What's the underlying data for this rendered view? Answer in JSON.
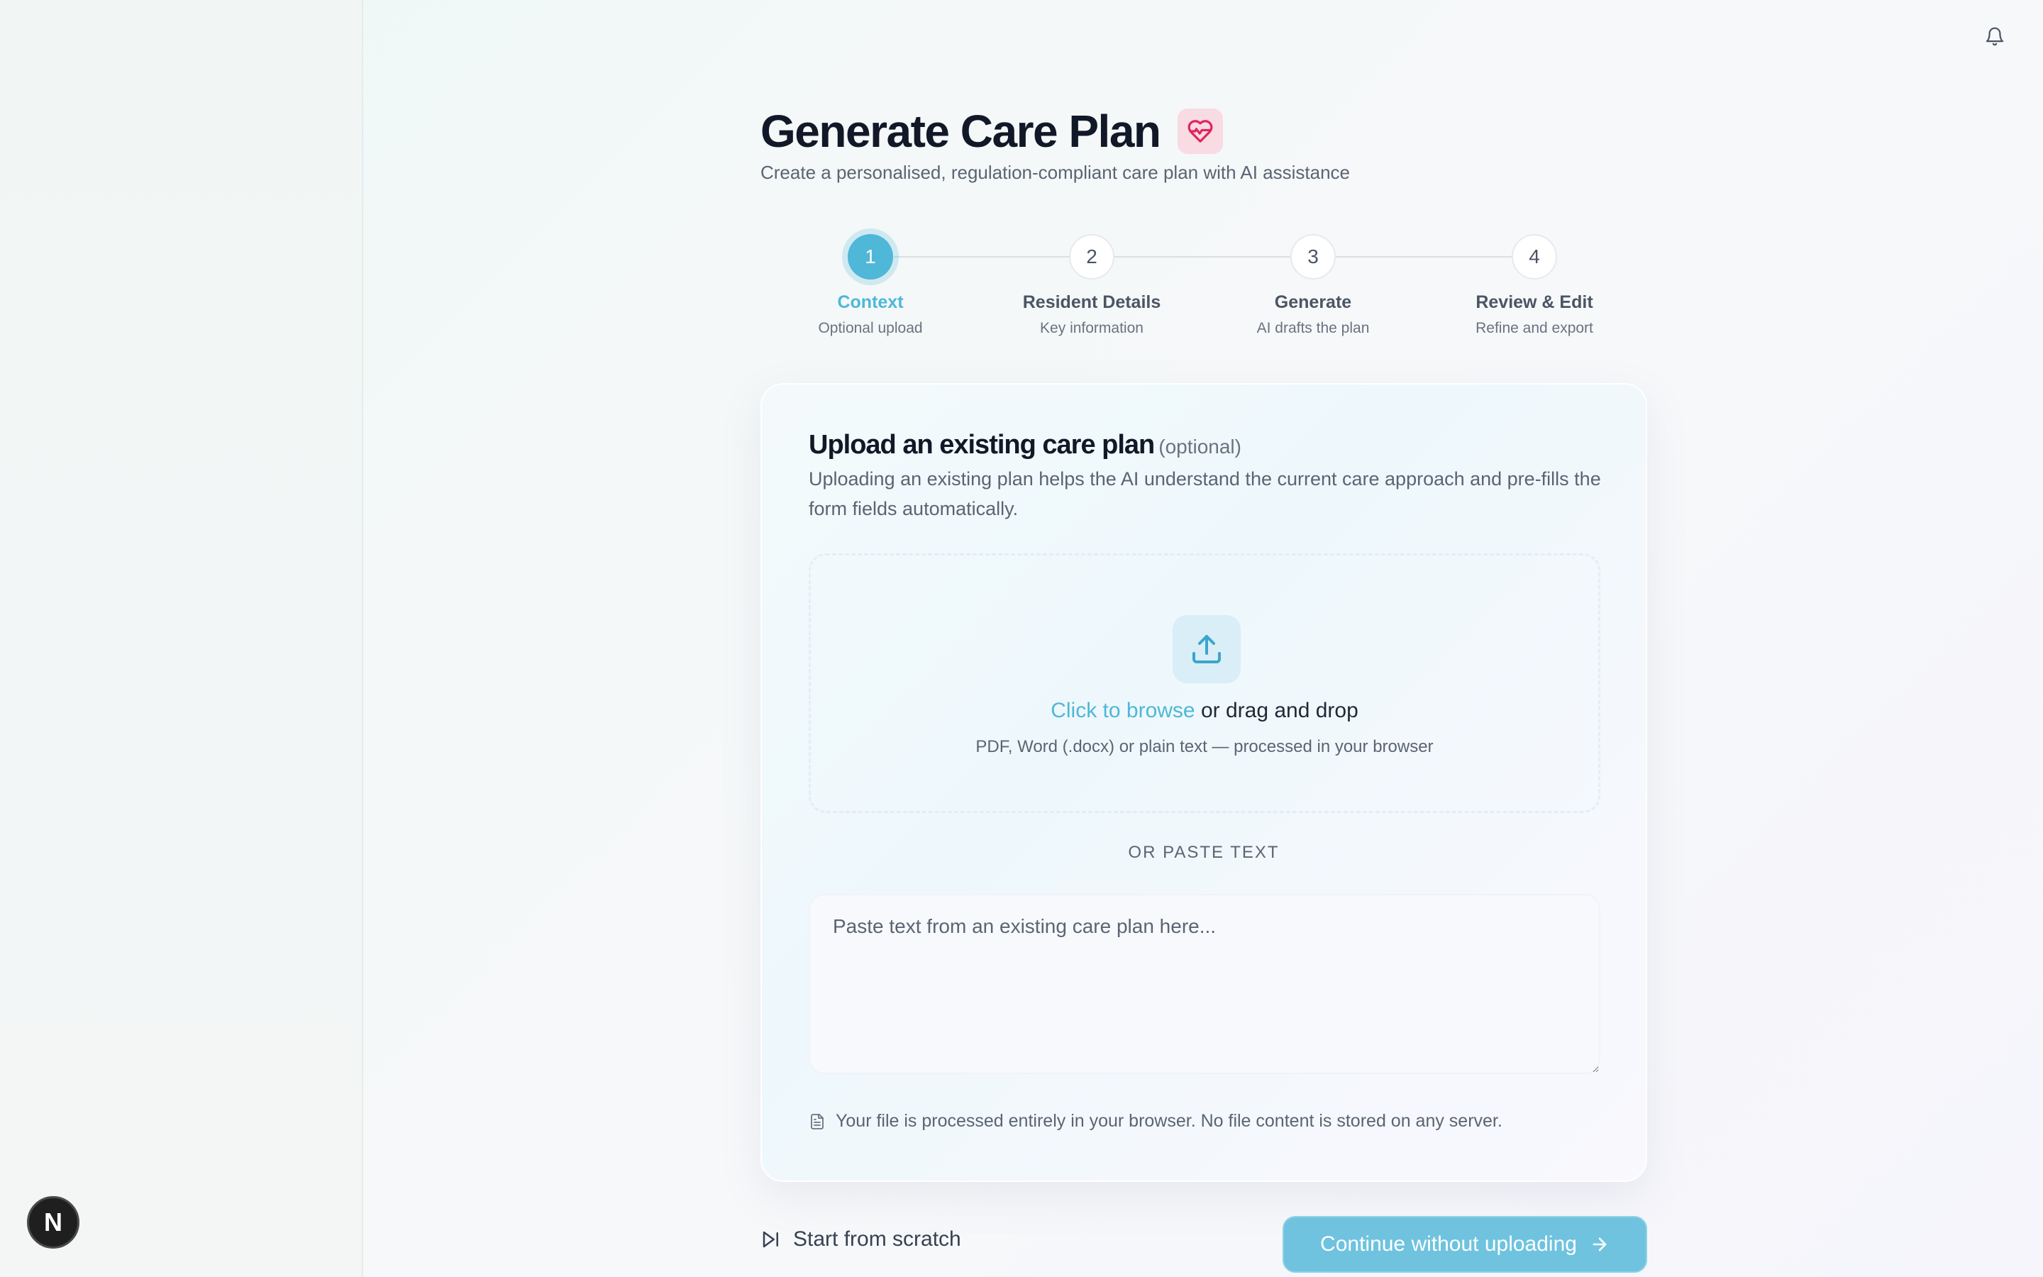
{
  "page": {
    "title": "Generate Care Plan",
    "subtitle": "Create a personalised, regulation-compliant care plan with AI assistance",
    "title_icon": "heart-pulse-icon"
  },
  "header": {
    "notification_icon": "bell-icon"
  },
  "sidebar": {
    "badge_letter": "N"
  },
  "stepper": {
    "steps": [
      {
        "number": "1",
        "label": "Context",
        "sub": "Optional upload",
        "active": true
      },
      {
        "number": "2",
        "label": "Resident Details",
        "sub": "Key information",
        "active": false
      },
      {
        "number": "3",
        "label": "Generate",
        "sub": "AI drafts the plan",
        "active": false
      },
      {
        "number": "4",
        "label": "Review & Edit",
        "sub": "Refine and export",
        "active": false
      }
    ]
  },
  "card": {
    "title": "Upload an existing care plan",
    "title_optional": "(optional)",
    "description": "Uploading an existing plan helps the AI understand the current care approach and pre-fills the form fields automatically.",
    "dropzone": {
      "link_text": "Click to browse",
      "rest_text": " or drag and drop",
      "hint": "PDF, Word (.docx) or plain text — processed in your browser"
    },
    "or_paste": "OR PASTE TEXT",
    "paste_placeholder": "Paste text from an existing care plan here...",
    "privacy_note": "Your file is processed entirely in your browser. No file content is stored on any server."
  },
  "footer": {
    "start_scratch": "Start from scratch",
    "continue": "Continue without uploading"
  },
  "colors": {
    "accent": "#4fb7d8",
    "button": "#6fc3df",
    "heart": "#e0245e"
  }
}
